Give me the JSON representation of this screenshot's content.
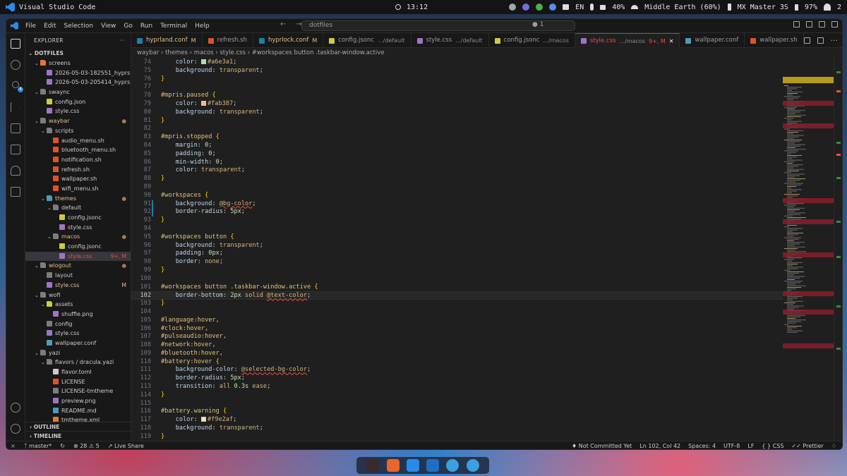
{
  "topbar": {
    "app_title": "Visual Studio Code",
    "clock": "13:12",
    "lang": "EN",
    "volume": "40%",
    "network": "Middle Earth (60%)",
    "bluetooth": "MX Master 3S",
    "battery": "97%",
    "notifications": "2"
  },
  "titlebar": {
    "menus": [
      "File",
      "Edit",
      "Selection",
      "View",
      "Go",
      "Run",
      "Terminal",
      "Help"
    ],
    "search": "dotfiles",
    "scm_count": "1"
  },
  "sidebar": {
    "title": "EXPLORER",
    "root": "DOTFILES",
    "outline": "OUTLINE",
    "timeline": "TIMELINE",
    "tree": [
      {
        "label": "screens",
        "depth": 1,
        "kind": "folder",
        "open": true,
        "color": "#e37933"
      },
      {
        "label": "2026-05-03-182551_hyprs...",
        "depth": 2,
        "kind": "file",
        "color": "#a074c4"
      },
      {
        "label": "2026-05-03-205414_hyprs...",
        "depth": 2,
        "kind": "file",
        "color": "#a074c4"
      },
      {
        "label": "swaync",
        "depth": 1,
        "kind": "folder",
        "open": true,
        "color": "#7d7d7d"
      },
      {
        "label": "config.json",
        "depth": 2,
        "kind": "file",
        "color": "#cbcb41"
      },
      {
        "label": "style.css",
        "depth": 2,
        "kind": "file",
        "color": "#a074c4"
      },
      {
        "label": "waybar",
        "depth": 1,
        "kind": "folder",
        "open": true,
        "color": "#7d7d7d",
        "mod": true,
        "dot": true
      },
      {
        "label": "scripts",
        "depth": 2,
        "kind": "folder",
        "open": true,
        "color": "#7d7d7d"
      },
      {
        "label": "audio_menu.sh",
        "depth": 3,
        "kind": "file",
        "color": "#e0532a"
      },
      {
        "label": "bluetooth_menu.sh",
        "depth": 3,
        "kind": "file",
        "color": "#e0532a"
      },
      {
        "label": "notification.sh",
        "depth": 3,
        "kind": "file",
        "color": "#e0532a"
      },
      {
        "label": "refresh.sh",
        "depth": 3,
        "kind": "file",
        "color": "#e0532a"
      },
      {
        "label": "wallpaper.sh",
        "depth": 3,
        "kind": "file",
        "color": "#e0532a"
      },
      {
        "label": "wifi_menu.sh",
        "depth": 3,
        "kind": "file",
        "color": "#e0532a"
      },
      {
        "label": "themes",
        "depth": 2,
        "kind": "folder",
        "open": true,
        "color": "#519aba",
        "mod": true,
        "dot": true
      },
      {
        "label": "default",
        "depth": 3,
        "kind": "folder",
        "open": true,
        "color": "#7d7d7d"
      },
      {
        "label": "config.jsonc",
        "depth": 4,
        "kind": "file",
        "color": "#cbcb41"
      },
      {
        "label": "style.css",
        "depth": 4,
        "kind": "file",
        "color": "#a074c4"
      },
      {
        "label": "macos",
        "depth": 3,
        "kind": "folder",
        "open": true,
        "color": "#7d7d7d",
        "mod": true,
        "dot": true
      },
      {
        "label": "config.jsonc",
        "depth": 4,
        "kind": "file",
        "color": "#cbcb41"
      },
      {
        "label": "style.css",
        "depth": 4,
        "kind": "file",
        "color": "#a074c4",
        "mod": true,
        "selected": true,
        "deco": "9+, M"
      },
      {
        "label": "wlogout",
        "depth": 1,
        "kind": "folder",
        "open": true,
        "color": "#7d7d7d",
        "mod": true,
        "dot": true
      },
      {
        "label": "layout",
        "depth": 2,
        "kind": "file",
        "color": "#7d7d7d"
      },
      {
        "label": "style.css",
        "depth": 2,
        "kind": "file",
        "color": "#a074c4",
        "mod": true,
        "deco": "M"
      },
      {
        "label": "wofi",
        "depth": 1,
        "kind": "folder",
        "open": true,
        "color": "#7d7d7d"
      },
      {
        "label": "assets",
        "depth": 2,
        "kind": "folder",
        "open": true,
        "color": "#cbcb41"
      },
      {
        "label": "shuffle.png",
        "depth": 3,
        "kind": "file",
        "color": "#a074c4"
      },
      {
        "label": "config",
        "depth": 2,
        "kind": "file",
        "color": "#7d7d7d"
      },
      {
        "label": "style.css",
        "depth": 2,
        "kind": "file",
        "color": "#a074c4"
      },
      {
        "label": "wallpaper.conf",
        "depth": 2,
        "kind": "file",
        "color": "#519aba"
      },
      {
        "label": "yazi",
        "depth": 1,
        "kind": "folder",
        "open": true,
        "color": "#7d7d7d"
      },
      {
        "label": "flavors / dracula.yazi",
        "depth": 2,
        "kind": "folder",
        "open": true,
        "color": "#7d7d7d"
      },
      {
        "label": "flavor.toml",
        "depth": 3,
        "kind": "file",
        "color": "#cccccc"
      },
      {
        "label": "LICENSE",
        "depth": 3,
        "kind": "file",
        "color": "#e0532a"
      },
      {
        "label": "LICENSE-tmtheme",
        "depth": 3,
        "kind": "file",
        "color": "#7d7d7d"
      },
      {
        "label": "preview.png",
        "depth": 3,
        "kind": "file",
        "color": "#a074c4"
      },
      {
        "label": "README.md",
        "depth": 3,
        "kind": "file",
        "color": "#519aba"
      },
      {
        "label": "tmtheme.xml",
        "depth": 3,
        "kind": "file",
        "color": "#e37933"
      }
    ]
  },
  "tabs": [
    {
      "label": "hyprland.conf",
      "desc": "",
      "mark": "M",
      "icon_color": "#1b81a8",
      "active": false
    },
    {
      "label": "refresh.sh",
      "desc": "",
      "mark": "",
      "icon_color": "#e0532a",
      "active": false
    },
    {
      "label": "hyprlock.conf",
      "desc": "",
      "mark": "M",
      "icon_color": "#1b81a8",
      "active": false
    },
    {
      "label": "config.jsonc",
      "desc": ".../default",
      "mark": "",
      "icon_color": "#cbcb41",
      "active": false
    },
    {
      "label": "style.css",
      "desc": ".../default",
      "mark": "",
      "icon_color": "#a074c4",
      "active": false
    },
    {
      "label": "config.jsonc",
      "desc": ".../macos",
      "mark": "",
      "icon_color": "#cbcb41",
      "active": false
    },
    {
      "label": "style.css",
      "desc": ".../macos",
      "mark": "9+, M",
      "icon_color": "#a074c4",
      "active": true
    },
    {
      "label": "wallpaper.conf",
      "desc": "",
      "mark": "",
      "icon_color": "#519aba",
      "active": false
    },
    {
      "label": "wallpaper.sh",
      "desc": "",
      "mark": "",
      "icon_color": "#e0532a",
      "active": false
    }
  ],
  "breadcrumb": "waybar › themes › macos › style.css › #workspaces button .taskbar-window.active",
  "code": [
    {
      "n": 74,
      "mod": false,
      "t": [
        [
          "    ",
          "k-punct"
        ],
        [
          "color",
          "k-prop"
        ],
        [
          ": ",
          "k-punct"
        ],
        [
          "#a6e3a1",
          "k-val",
          "#a6e3a1"
        ],
        [
          ";",
          "k-punct"
        ]
      ]
    },
    {
      "n": 75,
      "t": [
        [
          "    ",
          "k-punct"
        ],
        [
          "background",
          "k-prop"
        ],
        [
          ": ",
          "k-punct"
        ],
        [
          "transparent",
          "k-val"
        ],
        [
          ";",
          "k-punct"
        ]
      ]
    },
    {
      "n": 76,
      "t": [
        [
          "}",
          "k-brace"
        ]
      ]
    },
    {
      "n": 77,
      "t": []
    },
    {
      "n": 78,
      "t": [
        [
          "#mpris.paused ",
          "k-sel"
        ],
        [
          "{",
          "k-brace"
        ]
      ]
    },
    {
      "n": 79,
      "t": [
        [
          "    ",
          "k-punct"
        ],
        [
          "color",
          "k-prop"
        ],
        [
          ": ",
          "k-punct"
        ],
        [
          "#fab387",
          "k-val",
          "#fab387"
        ],
        [
          ";",
          "k-punct"
        ]
      ]
    },
    {
      "n": 80,
      "t": [
        [
          "    ",
          "k-punct"
        ],
        [
          "background",
          "k-prop"
        ],
        [
          ": ",
          "k-punct"
        ],
        [
          "transparent",
          "k-val"
        ],
        [
          ";",
          "k-punct"
        ]
      ]
    },
    {
      "n": 81,
      "t": [
        [
          "}",
          "k-brace"
        ]
      ]
    },
    {
      "n": 82,
      "t": []
    },
    {
      "n": 83,
      "t": [
        [
          "#mpris.stopped ",
          "k-sel"
        ],
        [
          "{",
          "k-brace"
        ]
      ]
    },
    {
      "n": 84,
      "t": [
        [
          "    ",
          "k-punct"
        ],
        [
          "margin",
          "k-prop"
        ],
        [
          ": ",
          "k-punct"
        ],
        [
          "0",
          "k-num"
        ],
        [
          ";",
          "k-punct"
        ]
      ]
    },
    {
      "n": 85,
      "t": [
        [
          "    ",
          "k-punct"
        ],
        [
          "padding",
          "k-prop"
        ],
        [
          ": ",
          "k-punct"
        ],
        [
          "0",
          "k-num"
        ],
        [
          ";",
          "k-punct"
        ]
      ]
    },
    {
      "n": 86,
      "t": [
        [
          "    ",
          "k-punct"
        ],
        [
          "min-width",
          "k-prop"
        ],
        [
          ": ",
          "k-punct"
        ],
        [
          "0",
          "k-num"
        ],
        [
          ";",
          "k-punct"
        ]
      ]
    },
    {
      "n": 87,
      "t": [
        [
          "    ",
          "k-punct"
        ],
        [
          "color",
          "k-prop"
        ],
        [
          ": ",
          "k-punct"
        ],
        [
          "transparent",
          "k-val"
        ],
        [
          ";",
          "k-punct"
        ]
      ]
    },
    {
      "n": 88,
      "t": [
        [
          "}",
          "k-brace"
        ]
      ]
    },
    {
      "n": 89,
      "t": []
    },
    {
      "n": 90,
      "t": [
        [
          "#workspaces ",
          "k-sel"
        ],
        [
          "{",
          "k-brace"
        ]
      ]
    },
    {
      "n": 91,
      "mod": true,
      "t": [
        [
          "    ",
          "k-punct"
        ],
        [
          "background",
          "k-prop"
        ],
        [
          ": ",
          "k-punct"
        ],
        [
          "@bg-color",
          "k-var"
        ],
        [
          ";",
          "k-punct"
        ]
      ]
    },
    {
      "n": 92,
      "mod": true,
      "t": [
        [
          "    ",
          "k-punct"
        ],
        [
          "border-radius",
          "k-prop"
        ],
        [
          ": ",
          "k-punct"
        ],
        [
          "5px",
          "k-num"
        ],
        [
          ";",
          "k-punct"
        ]
      ]
    },
    {
      "n": 93,
      "t": [
        [
          "}",
          "k-brace"
        ]
      ]
    },
    {
      "n": 94,
      "t": []
    },
    {
      "n": 95,
      "t": [
        [
          "#workspaces button ",
          "k-sel"
        ],
        [
          "{",
          "k-brace"
        ]
      ]
    },
    {
      "n": 96,
      "t": [
        [
          "    ",
          "k-punct"
        ],
        [
          "background",
          "k-prop"
        ],
        [
          ": ",
          "k-punct"
        ],
        [
          "transparent",
          "k-val"
        ],
        [
          ";",
          "k-punct"
        ]
      ]
    },
    {
      "n": 97,
      "t": [
        [
          "    ",
          "k-punct"
        ],
        [
          "padding",
          "k-prop"
        ],
        [
          ": ",
          "k-punct"
        ],
        [
          "0px",
          "k-num"
        ],
        [
          ";",
          "k-punct"
        ]
      ]
    },
    {
      "n": 98,
      "t": [
        [
          "    ",
          "k-punct"
        ],
        [
          "border",
          "k-prop"
        ],
        [
          ": ",
          "k-punct"
        ],
        [
          "none",
          "k-val"
        ],
        [
          ";",
          "k-punct"
        ]
      ]
    },
    {
      "n": 99,
      "t": [
        [
          "}",
          "k-brace"
        ]
      ]
    },
    {
      "n": 100,
      "t": []
    },
    {
      "n": 101,
      "t": [
        [
          "#workspaces button .taskbar-window.active ",
          "k-sel"
        ],
        [
          "{",
          "k-brace"
        ]
      ]
    },
    {
      "n": 102,
      "cur": true,
      "t": [
        [
          "    ",
          "k-punct"
        ],
        [
          "border-bottom",
          "k-prop"
        ],
        [
          ": ",
          "k-punct"
        ],
        [
          "2px",
          "k-num"
        ],
        [
          " solid ",
          "k-val"
        ],
        [
          "@text-color",
          "k-var"
        ],
        [
          ";",
          "k-punct"
        ]
      ]
    },
    {
      "n": 103,
      "t": [
        [
          "}",
          "k-brace"
        ]
      ]
    },
    {
      "n": 104,
      "t": []
    },
    {
      "n": 105,
      "t": [
        [
          "#language:hover,",
          "k-sel"
        ]
      ]
    },
    {
      "n": 106,
      "t": [
        [
          "#clock:hover,",
          "k-sel"
        ]
      ]
    },
    {
      "n": 107,
      "t": [
        [
          "#pulseaudio:hover,",
          "k-sel"
        ]
      ]
    },
    {
      "n": 108,
      "t": [
        [
          "#network:hover,",
          "k-sel"
        ]
      ]
    },
    {
      "n": 109,
      "t": [
        [
          "#bluetooth:hover,",
          "k-sel"
        ]
      ]
    },
    {
      "n": 110,
      "t": [
        [
          "#battery:hover ",
          "k-sel"
        ],
        [
          "{",
          "k-brace"
        ]
      ]
    },
    {
      "n": 111,
      "t": [
        [
          "    ",
          "k-punct"
        ],
        [
          "background-color",
          "k-prop"
        ],
        [
          ": ",
          "k-punct"
        ],
        [
          "@selected-bg-color",
          "k-var"
        ],
        [
          ";",
          "k-punct"
        ]
      ]
    },
    {
      "n": 112,
      "t": [
        [
          "    ",
          "k-punct"
        ],
        [
          "border-radius",
          "k-prop"
        ],
        [
          ": ",
          "k-punct"
        ],
        [
          "5px",
          "k-num"
        ],
        [
          ";",
          "k-punct"
        ]
      ]
    },
    {
      "n": 113,
      "t": [
        [
          "    ",
          "k-punct"
        ],
        [
          "transition",
          "k-prop"
        ],
        [
          ": ",
          "k-punct"
        ],
        [
          "all ",
          "k-val"
        ],
        [
          "0.3s",
          "k-num"
        ],
        [
          " ease",
          "k-val"
        ],
        [
          ";",
          "k-punct"
        ]
      ]
    },
    {
      "n": 114,
      "t": [
        [
          "}",
          "k-brace"
        ]
      ]
    },
    {
      "n": 115,
      "t": []
    },
    {
      "n": 116,
      "t": [
        [
          "#battery.warning ",
          "k-sel"
        ],
        [
          "{",
          "k-brace"
        ]
      ]
    },
    {
      "n": 117,
      "t": [
        [
          "    ",
          "k-punct"
        ],
        [
          "color",
          "k-prop"
        ],
        [
          ": ",
          "k-punct"
        ],
        [
          "#f9e2af",
          "k-val",
          "#f9e2af"
        ],
        [
          ";",
          "k-punct"
        ]
      ]
    },
    {
      "n": 118,
      "t": [
        [
          "    ",
          "k-punct"
        ],
        [
          "background",
          "k-prop"
        ],
        [
          ": ",
          "k-punct"
        ],
        [
          "transparent",
          "k-val"
        ],
        [
          ";",
          "k-punct"
        ]
      ]
    },
    {
      "n": 119,
      "t": [
        [
          "}",
          "k-brace"
        ]
      ]
    }
  ],
  "status": {
    "branch": "master*",
    "errors": "28",
    "warnings": "5",
    "live_share": "Live Share",
    "commit": "Not Committed Yet",
    "position": "Ln 102, Col 42",
    "spaces": "Spaces: 4",
    "encoding": "UTF-8",
    "eol": "LF",
    "language": "CSS",
    "formatter": "Prettier"
  },
  "dock": {
    "items": [
      "terminal-icon",
      "firefox-icon",
      "vscode-icon",
      "vscode-insiders-icon",
      "browser-icon",
      "browser-icon"
    ]
  }
}
